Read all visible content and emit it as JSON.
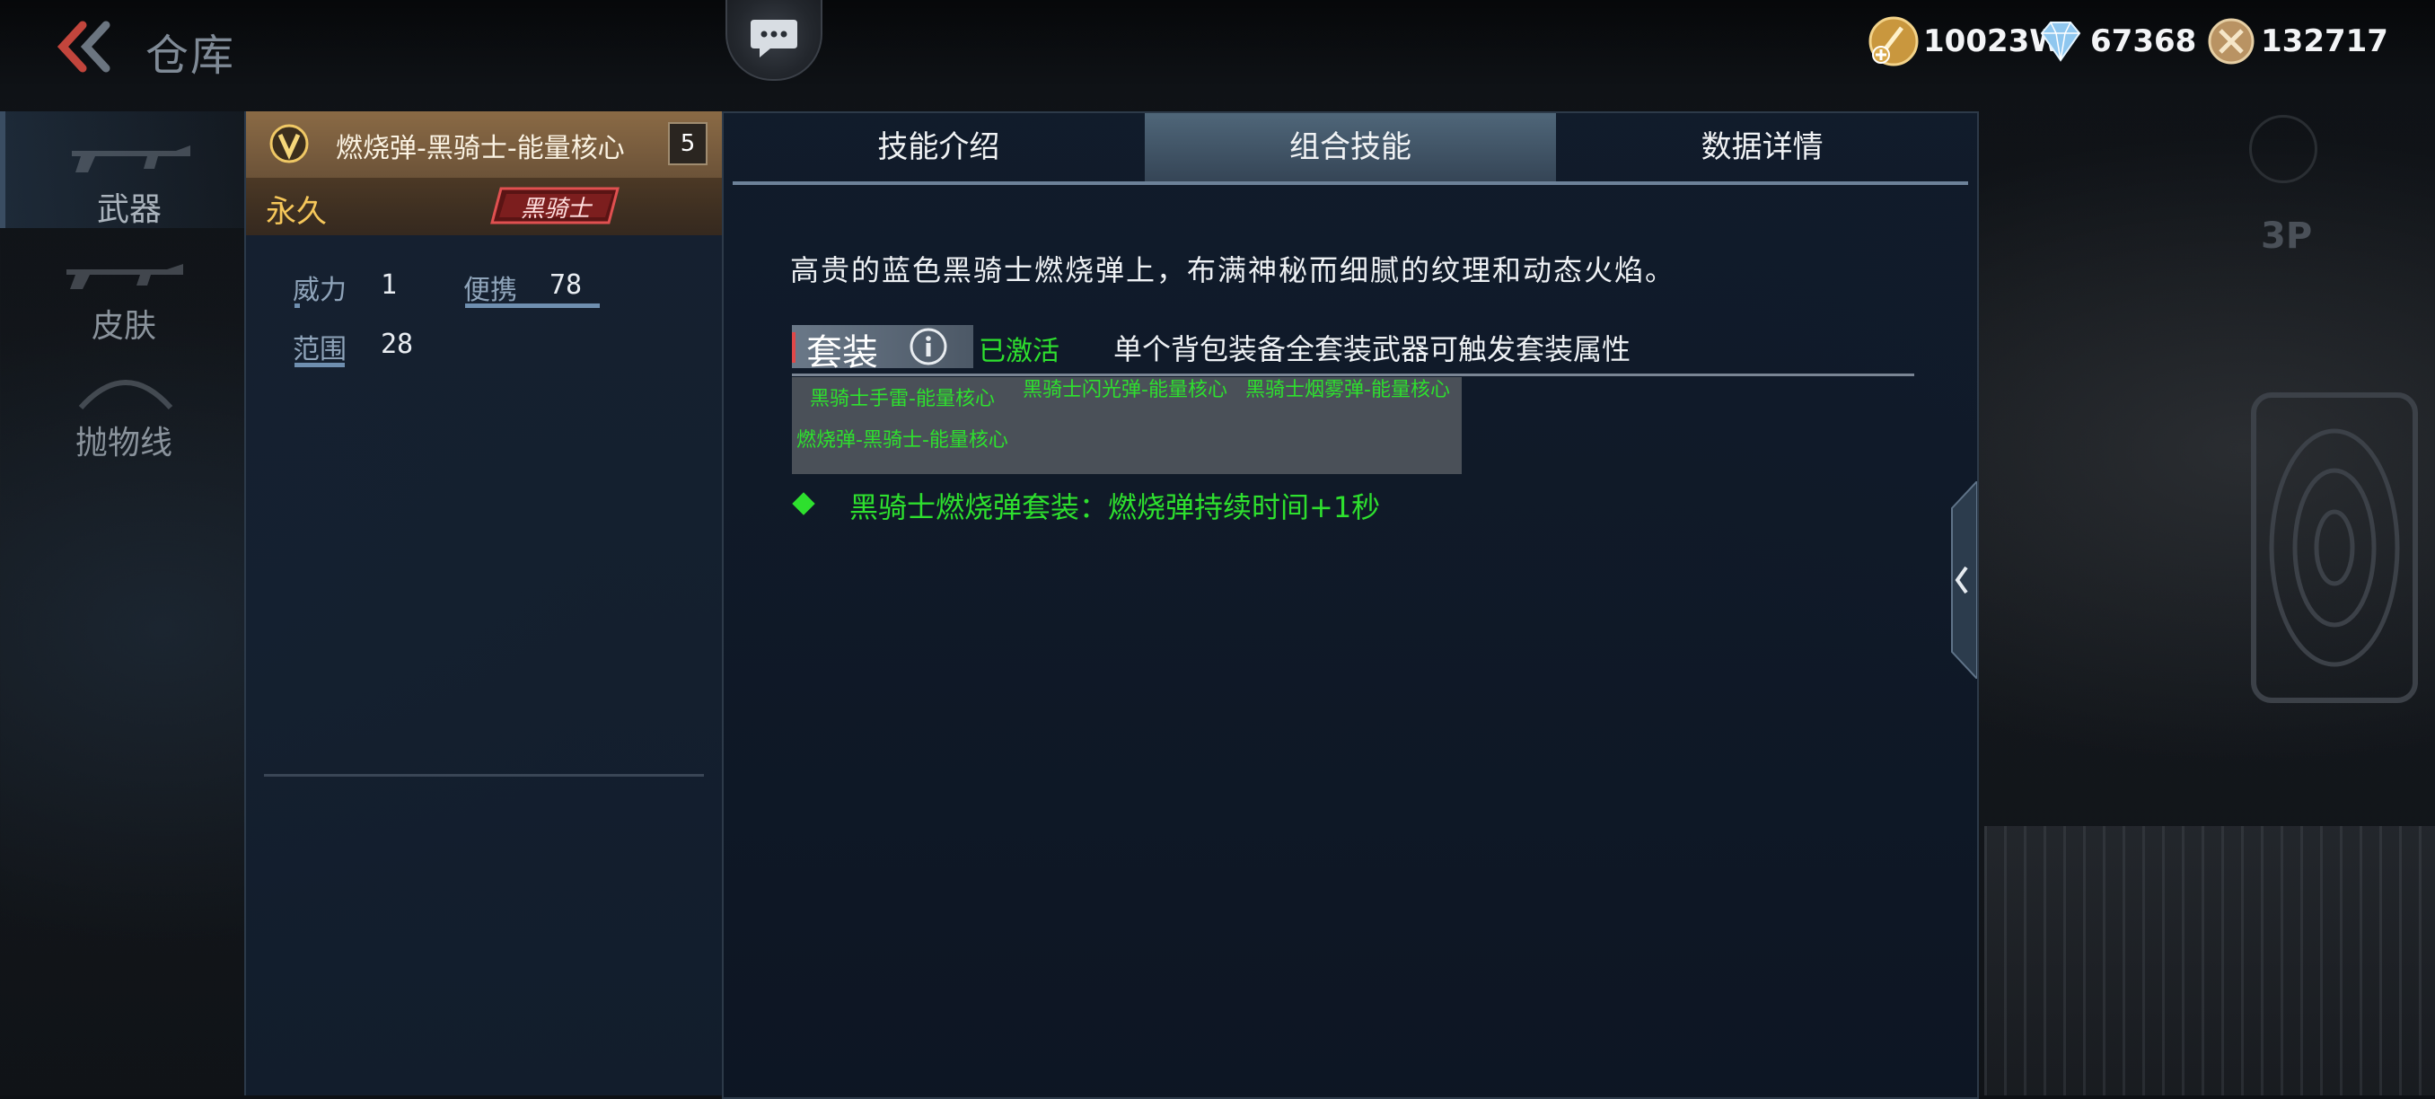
{
  "header": {
    "title": "仓库"
  },
  "currencies": [
    {
      "icon": "gold-coin-icon",
      "value": "10023W"
    },
    {
      "icon": "diamond-icon",
      "value": "67368"
    },
    {
      "icon": "medal-icon",
      "value": "132717"
    }
  ],
  "sidebar": {
    "items": [
      {
        "label": "武器",
        "active": true
      },
      {
        "label": "皮肤",
        "active": false
      },
      {
        "label": "抛物线",
        "active": false
      }
    ]
  },
  "item": {
    "name": "燃烧弹-黑骑士-能量核心",
    "level": "5",
    "duration": "永久",
    "badge": "黑骑士",
    "stats": [
      {
        "label": "威力",
        "value": "1"
      },
      {
        "label": "便携",
        "value": "78"
      },
      {
        "label": "范围",
        "value": "28"
      }
    ]
  },
  "tabs": [
    {
      "label": "技能介绍",
      "active": false
    },
    {
      "label": "组合技能",
      "active": true
    },
    {
      "label": "数据详情",
      "active": false
    }
  ],
  "content": {
    "description": "高贵的蓝色黑骑士燃烧弹上，布满神秘而细腻的纹理和动态火焰。",
    "set_label": "套装",
    "set_status": "已激活",
    "set_note": "单个背包装备全套装武器可触发套装属性",
    "set_pieces": [
      "黑骑士手雷-能量核心",
      "黑骑士闪光弹-能量核心",
      "黑骑士烟雾弹-能量核心",
      "燃烧弹-黑骑士-能量核心"
    ],
    "set_bonus": "黑骑士燃烧弹套装：燃烧弹持续时间+1秒"
  },
  "background": {
    "camera_label": "3P"
  },
  "colors": {
    "accent_green": "#2ee02e",
    "gold": "#f6c75a",
    "tab_active": "#4f6679"
  }
}
